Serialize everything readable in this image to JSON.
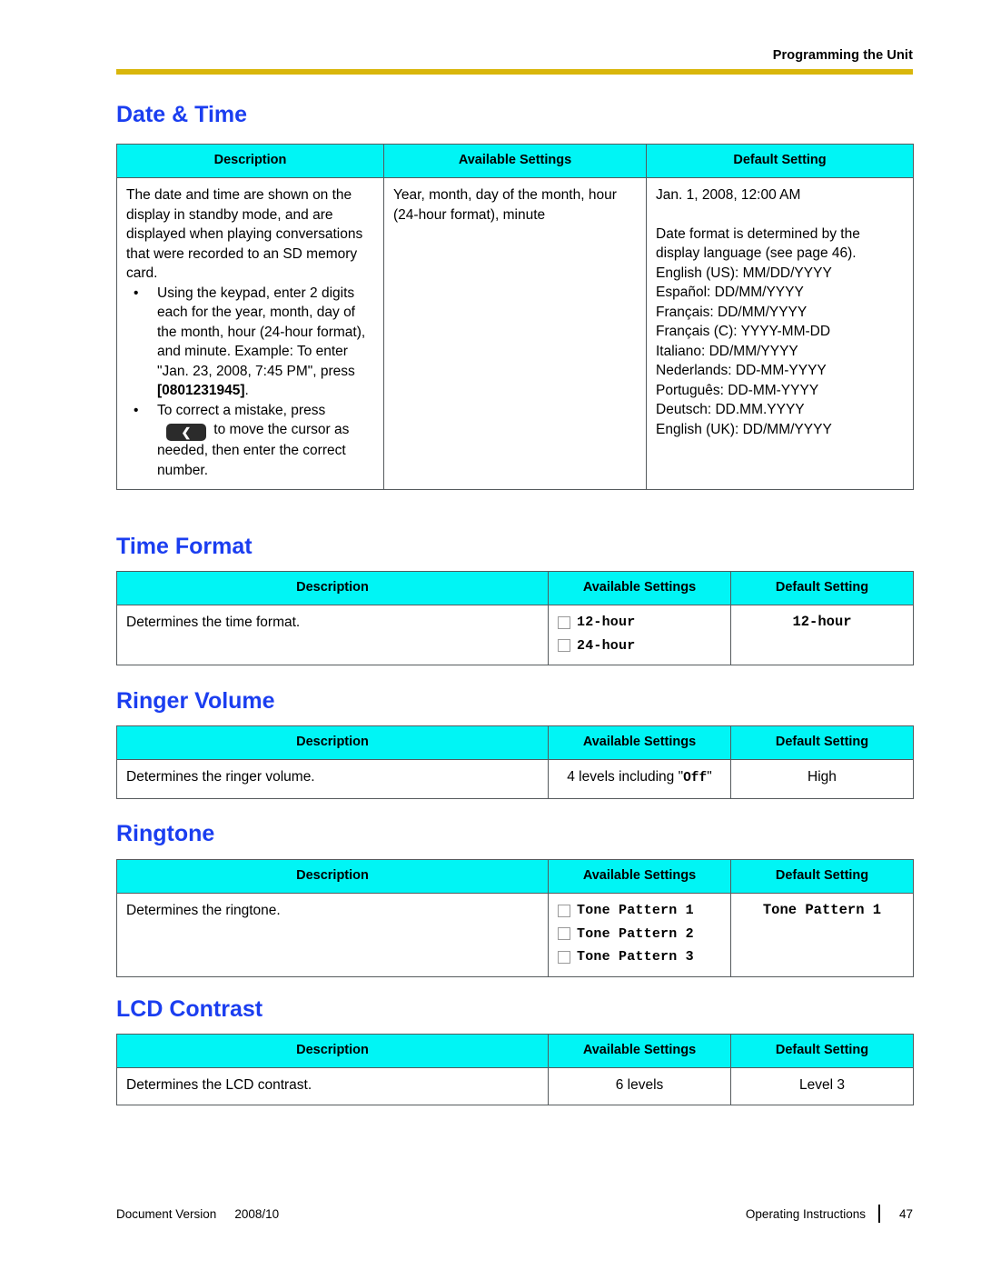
{
  "header": {
    "running_head": "Programming the Unit",
    "rule_color": "#d9b60b"
  },
  "theme": {
    "heading_color": "#1b3ef0",
    "table_header_bg": "#00f5f5",
    "table_border": "#555a5d"
  },
  "columns": {
    "description": "Description",
    "available": "Available Settings",
    "default": "Default Setting"
  },
  "sections": [
    {
      "title": "Date & Time",
      "description": {
        "paragraph": "The date and time are shown on the display in standby mode, and are displayed when playing conversations that were recorded to an SD memory card.",
        "bullets": [
          {
            "text_before": "Using the keypad, enter 2 digits each for the year, month, day of the month, hour (24-hour format), and minute. Example: To enter \"Jan. 23, 2008, 7:45 PM\", press ",
            "bold_value": "[0801231945]",
            "text_after": "."
          },
          {
            "text_before": "To correct a mistake, press ",
            "key_glyph": "❮",
            "key_glyph_name": "left-arrow-key",
            "text_after": " to move the cursor as needed, then enter the correct number."
          }
        ]
      },
      "available": "Year, month, day of the month, hour (24-hour format), minute",
      "default": {
        "value": "Jan. 1, 2008, 12:00 AM",
        "note": "Date format is determined by the display language (see page 46).",
        "formats": [
          "English (US): MM/DD/YYYY",
          "Español: DD/MM/YYYY",
          "Français: DD/MM/YYYY",
          "Français (C): YYYY-MM-DD",
          "Italiano: DD/MM/YYYY",
          "Nederlands: DD-MM-YYYY",
          "Português: DD-MM-YYYY",
          "Deutsch: DD.MM.YYYY",
          "English (UK): DD/MM/YYYY"
        ]
      }
    },
    {
      "title": "Time Format",
      "description": "Determines the time format.",
      "options": [
        "12-hour",
        "24-hour"
      ],
      "default": "12-hour"
    },
    {
      "title": "Ringer Volume",
      "description": "Determines the ringer volume.",
      "available_prefix": "4 levels including \"",
      "available_mono": "Off",
      "available_suffix": "\"",
      "default": "High"
    },
    {
      "title": "Ringtone",
      "description": "Determines the ringtone.",
      "options": [
        "Tone Pattern 1",
        "Tone Pattern 2",
        "Tone Pattern 3"
      ],
      "default": "Tone Pattern 1"
    },
    {
      "title": "LCD Contrast",
      "description": "Determines the LCD contrast.",
      "available": "6 levels",
      "default": "Level 3"
    }
  ],
  "footer": {
    "doc_version_label": "Document Version",
    "doc_version_value": "2008/10",
    "manual_name": "Operating Instructions",
    "page_number": "47"
  }
}
